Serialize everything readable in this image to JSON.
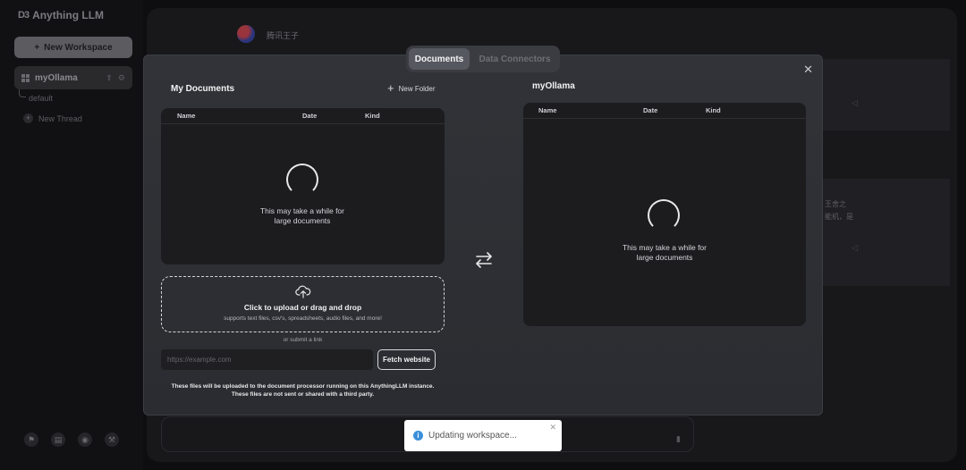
{
  "app": {
    "brand": "Anything LLM",
    "brand_mark": "D3"
  },
  "sidebar": {
    "new_workspace_label": "New Workspace",
    "workspace_name": "myOllama",
    "thread_default": "default",
    "new_thread_label": "New Thread"
  },
  "background_chat": {
    "bot_name": "腾讯王子",
    "cjk_snippet_line1": "王舍之",
    "cjk_snippet_line2": "能机，是"
  },
  "modal": {
    "tabs": [
      {
        "label": "Documents",
        "active": true
      },
      {
        "label": "Data Connectors",
        "active": false
      }
    ],
    "close_glyph": "✕",
    "my_documents": {
      "title": "My Documents",
      "new_folder_label": "New Folder",
      "columns": [
        "Name",
        "Date",
        "Kind"
      ],
      "loading_text_line1": "This may take a while for",
      "loading_text_line2": "large documents"
    },
    "workspace_docs": {
      "title": "myOllama",
      "columns": [
        "Name",
        "Date",
        "Kind"
      ],
      "loading_text_line1": "This may take a while for",
      "loading_text_line2": "large documents"
    },
    "upload": {
      "main_text": "Click to upload or drag and drop",
      "sub_text": "supports text files, csv's, spreadsheets, audio files, and more!",
      "or_text": "or submit a link",
      "url_placeholder": "https://example.com",
      "url_value": "",
      "fetch_label": "Fetch website",
      "disclaimer_line1": "These files will be uploaded to the document processor running on this AnythingLLM instance.",
      "disclaimer_line2": "These files are not sent or shared with a third party."
    }
  },
  "toast": {
    "message": "Updating workspace...",
    "icon": "info-icon",
    "close_glyph": "✕",
    "accent": "#3b8fd9"
  }
}
